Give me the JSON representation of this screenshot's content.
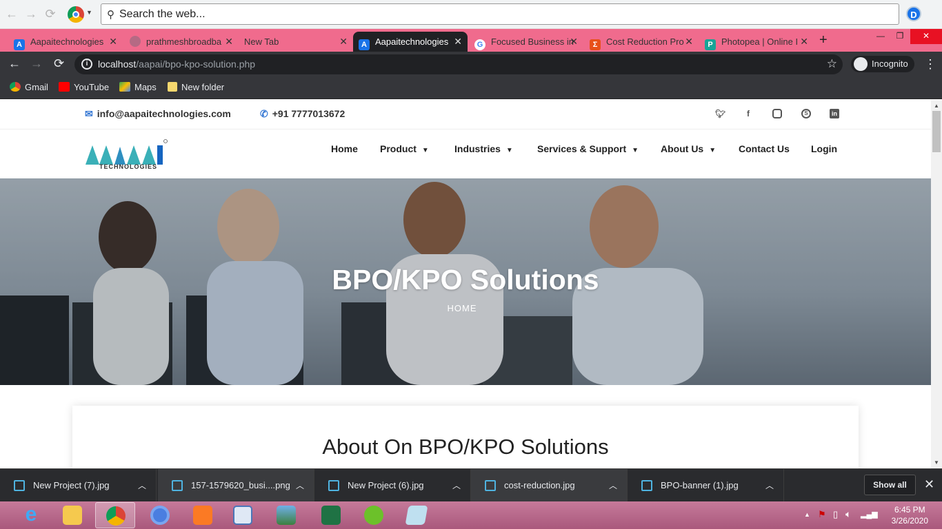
{
  "search_bar": {
    "placeholder": "Search the web..."
  },
  "profile_letter": "D",
  "tabs": [
    {
      "label": "Aapaitechnologies",
      "favicon": "A",
      "color": "#1a73e8"
    },
    {
      "label": "prathmeshbroadba",
      "favicon": "",
      "color": "#999999"
    },
    {
      "label": "New Tab",
      "favicon": "",
      "color": ""
    },
    {
      "label": "Aapaitechnologies",
      "favicon": "A",
      "color": "#1a73e8",
      "active": true
    },
    {
      "label": "Focused Business in",
      "favicon": "G",
      "color": "#ffffff"
    },
    {
      "label": "Cost Reduction Pro",
      "favicon": "Σ",
      "color": "#e8501a"
    },
    {
      "label": "Photopea | Online I",
      "favicon": "P",
      "color": "#18a497"
    }
  ],
  "address": {
    "host": "localhost",
    "path": "/aapai/bpo-kpo-solution.php"
  },
  "incognito_label": "Incognito",
  "bookmarks": [
    {
      "label": "Gmail"
    },
    {
      "label": "YouTube"
    },
    {
      "label": "Maps"
    },
    {
      "label": "New folder"
    }
  ],
  "site": {
    "email": "info@aapaitechnologies.com",
    "phone": "+91 7777013672",
    "social": [
      "twitter-icon",
      "facebook-icon",
      "instagram-icon",
      "skype-icon",
      "linkedin-icon"
    ],
    "logo_text": "AAPAI",
    "logo_sub": "TECHNOLOGIES",
    "nav": [
      {
        "label": "Home",
        "dropdown": false
      },
      {
        "label": "Product",
        "dropdown": true
      },
      {
        "label": "Industries",
        "dropdown": true
      },
      {
        "label": "Services & Support",
        "dropdown": true
      },
      {
        "label": "About Us",
        "dropdown": true
      },
      {
        "label": "Contact Us",
        "dropdown": false
      },
      {
        "label": "Login",
        "dropdown": false
      }
    ],
    "hero_title": "BPO/KPO Solutions",
    "hero_breadcrumb": "HOME",
    "about_title": "About On BPO/KPO Solutions"
  },
  "downloads": [
    {
      "name": "New Project (7).jpg"
    },
    {
      "name": "157-1579620_busi....png"
    },
    {
      "name": "New Project (6).jpg"
    },
    {
      "name": "cost-reduction.jpg"
    },
    {
      "name": "BPO-banner (1).jpg"
    }
  ],
  "show_all_label": "Show all",
  "clock": {
    "time": "6:45 PM",
    "date": "3/26/2020"
  },
  "colors": {
    "tabstrip": "#f06b8d",
    "brand_teal": "#3ab0b8",
    "brand_blue": "#1565c0"
  }
}
